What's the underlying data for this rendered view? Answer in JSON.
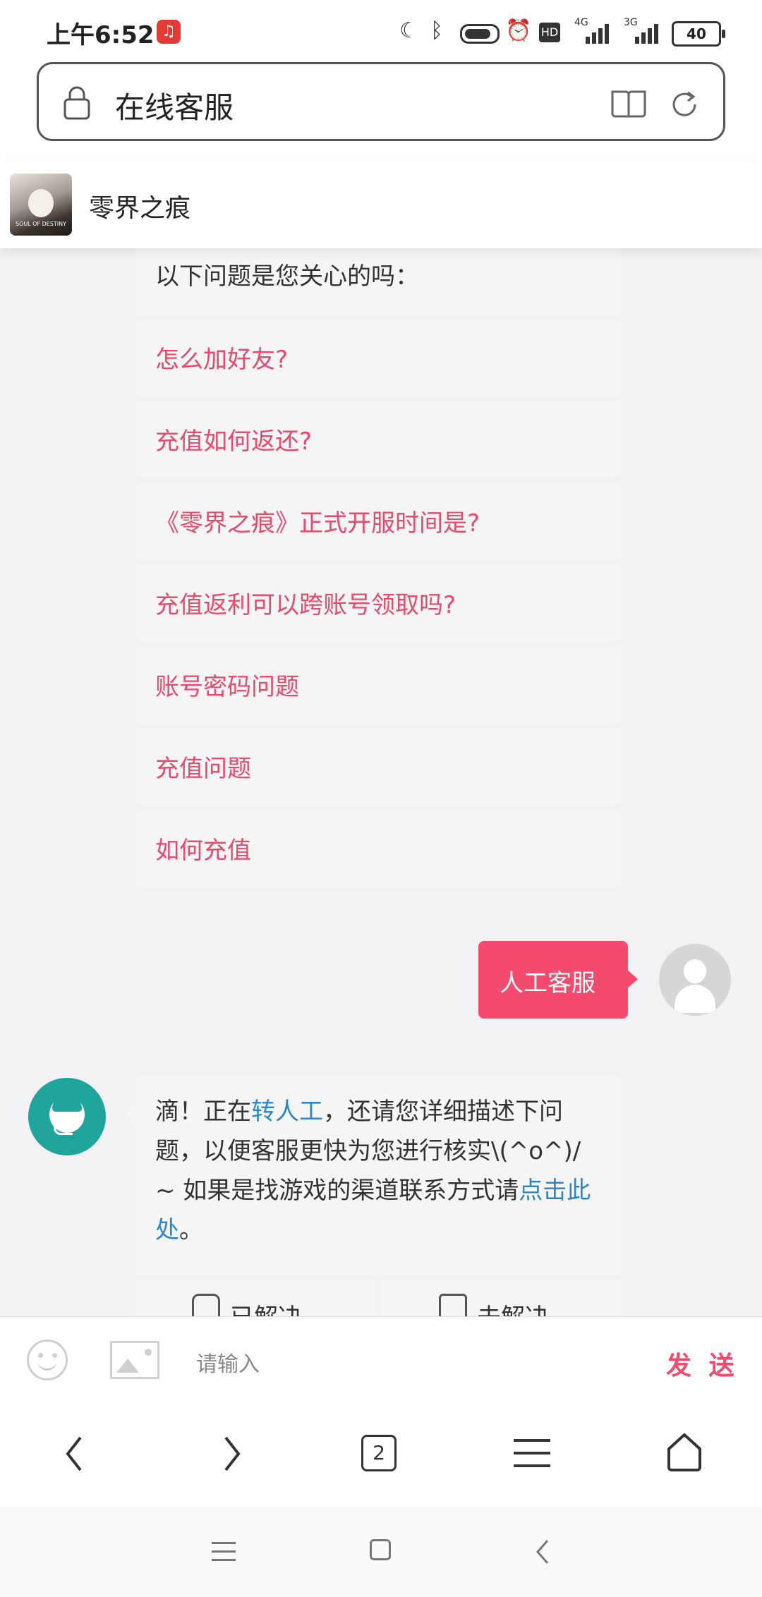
{
  "status_bar": {
    "time": "上午6:52",
    "app_icon": "netease-music-icon",
    "battery": "40",
    "net_a": "4G",
    "net_b": "3G"
  },
  "url_bar": {
    "title": "在线客服"
  },
  "header": {
    "game_name": "零界之痕",
    "logo_text": "SOUL OF DESTINY"
  },
  "chat": {
    "question_prompt": "以下问题是您关心的吗：",
    "questions": [
      "怎么加好友?",
      "充值如何返还?",
      "《零界之痕》正式开服时间是?",
      "充值返利可以跨账号领取吗?",
      "账号密码问题",
      "充值问题",
      "如何充值"
    ],
    "user_message": "人工客服",
    "agent_message": {
      "part1": "滴！正在",
      "link1": "转人工",
      "part2": "，还请您详细描述下问题，以便客服更快为您进行核实\\(^o^)/~ 如果是找游戏的渠道联系方式请",
      "link2": "点击此处",
      "part3": "。"
    },
    "feedback": {
      "resolved": "已解决",
      "unresolved": "未解决"
    }
  },
  "input_bar": {
    "placeholder": "请输入",
    "send_label": "发 送"
  },
  "browser_nav": {
    "tab_count": "2"
  },
  "colors": {
    "accent": "#f44a6e",
    "link": "#2b86c8",
    "agent_avatar": "#1fa59b"
  }
}
